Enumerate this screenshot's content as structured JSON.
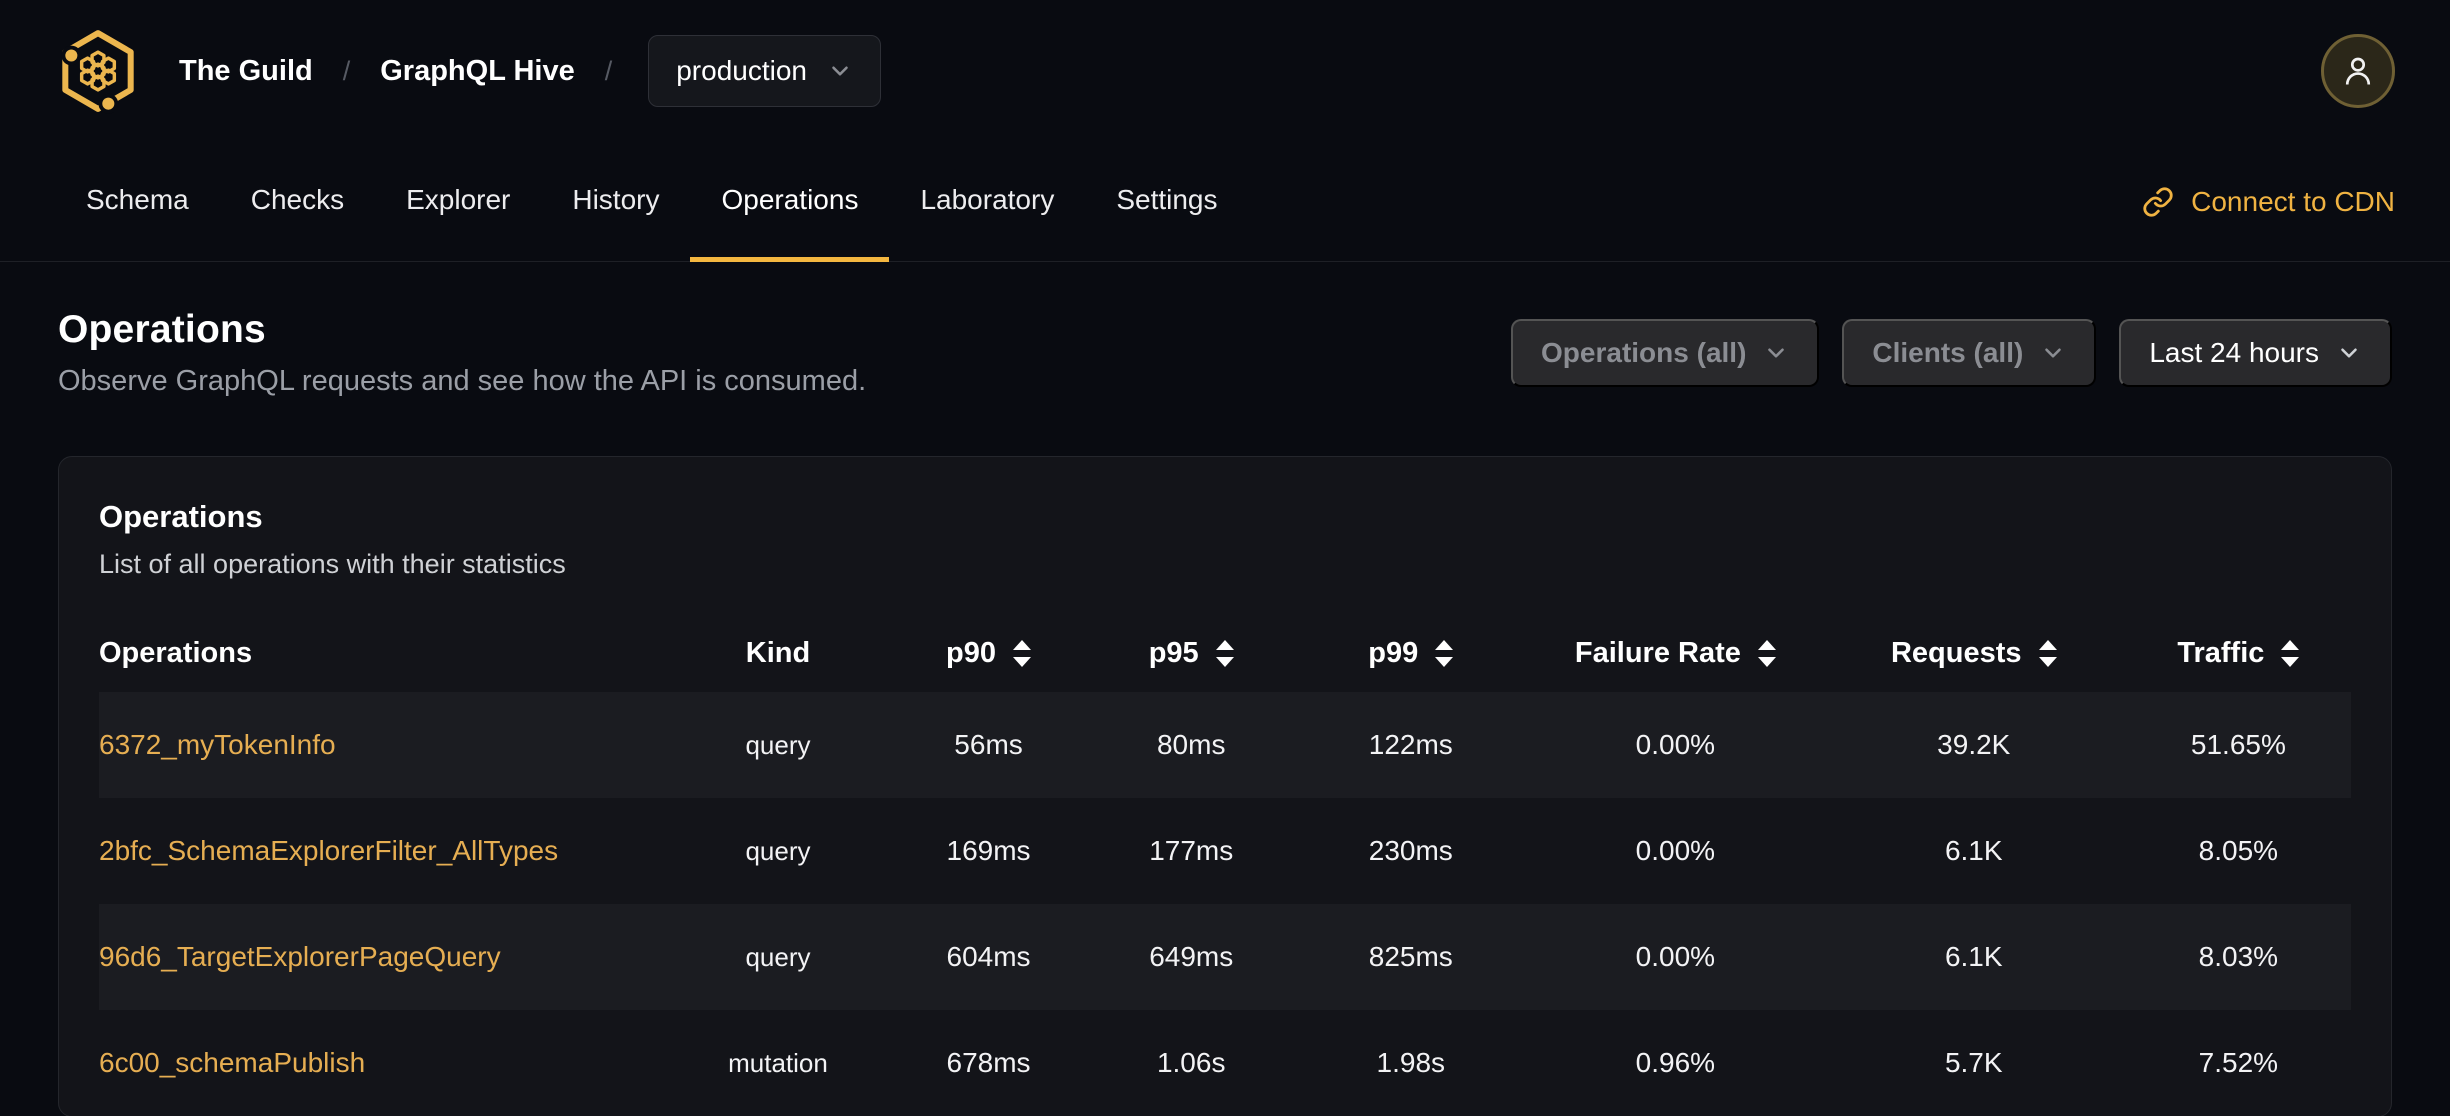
{
  "colors": {
    "accent": "#f4b740",
    "link": "#e6ae52",
    "page_bg": "#090b11",
    "card_bg": "#131419"
  },
  "topbar": {
    "org": "The Guild",
    "project": "GraphQL Hive",
    "separator": "/",
    "environment": "production"
  },
  "nav": {
    "tabs": [
      {
        "label": "Schema"
      },
      {
        "label": "Checks"
      },
      {
        "label": "Explorer"
      },
      {
        "label": "History"
      },
      {
        "label": "Operations"
      },
      {
        "label": "Laboratory"
      },
      {
        "label": "Settings"
      }
    ],
    "active_tab": "Operations",
    "cdn_link": "Connect to CDN"
  },
  "page_header": {
    "title": "Operations",
    "subtitle": "Observe GraphQL requests and see how the API is consumed."
  },
  "filters": {
    "operations_label": "Operations (all)",
    "clients_label": "Clients (all)",
    "period_label": "Last 24 hours"
  },
  "panel": {
    "title": "Operations",
    "subtitle": "List of all operations with their statistics"
  },
  "table": {
    "columns": [
      {
        "label": "Operations",
        "sortable": false
      },
      {
        "label": "Kind",
        "sortable": false
      },
      {
        "label": "p90",
        "sortable": true
      },
      {
        "label": "p95",
        "sortable": true
      },
      {
        "label": "p99",
        "sortable": true
      },
      {
        "label": "Failure Rate",
        "sortable": true
      },
      {
        "label": "Requests",
        "sortable": true
      },
      {
        "label": "Traffic",
        "sortable": true
      }
    ],
    "rows": [
      {
        "name": "6372_myTokenInfo",
        "kind": "query",
        "p90": "56ms",
        "p95": "80ms",
        "p99": "122ms",
        "failure_rate": "0.00%",
        "requests": "39.2K",
        "traffic": "51.65%"
      },
      {
        "name": "2bfc_SchemaExplorerFilter_AllTypes",
        "kind": "query",
        "p90": "169ms",
        "p95": "177ms",
        "p99": "230ms",
        "failure_rate": "0.00%",
        "requests": "6.1K",
        "traffic": "8.05%"
      },
      {
        "name": "96d6_TargetExplorerPageQuery",
        "kind": "query",
        "p90": "604ms",
        "p95": "649ms",
        "p99": "825ms",
        "failure_rate": "0.00%",
        "requests": "6.1K",
        "traffic": "8.03%"
      },
      {
        "name": "6c00_schemaPublish",
        "kind": "mutation",
        "p90": "678ms",
        "p95": "1.06s",
        "p99": "1.98s",
        "failure_rate": "0.96%",
        "requests": "5.7K",
        "traffic": "7.52%"
      }
    ]
  }
}
